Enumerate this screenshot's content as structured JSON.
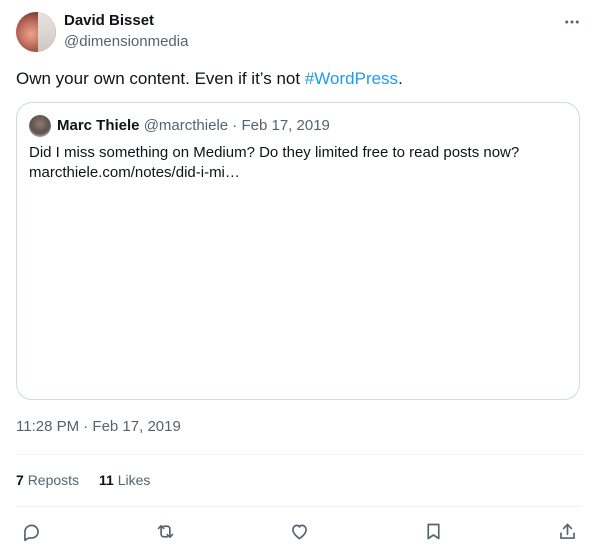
{
  "author": {
    "name": "David Bisset",
    "handle": "@dimensionmedia"
  },
  "tweet": {
    "text_before": "Own your own content. Even if it’s not ",
    "hashtag": "#WordPress",
    "text_after": "."
  },
  "quoted": {
    "name": "Marc Thiele",
    "handle": "@marcthiele",
    "separator": " · ",
    "date": "Feb 17, 2019",
    "text_line1": "Did I miss something on Medium? Do they limited free to read posts now?",
    "text_line2": "marcthiele.com/notes/did-i-mi…"
  },
  "meta": {
    "timestamp": "11:28 PM · Feb 17, 2019"
  },
  "stats": {
    "reposts_count": "7",
    "reposts_label": "Reposts",
    "likes_count": "11",
    "likes_label": "Likes"
  },
  "colors": {
    "accent": "#1d9bf0",
    "secondary_text": "#536471",
    "border": "#cfd9de"
  },
  "icons": [
    "more-icon",
    "reply-icon",
    "repost-icon",
    "like-icon",
    "bookmark-icon",
    "share-icon"
  ]
}
